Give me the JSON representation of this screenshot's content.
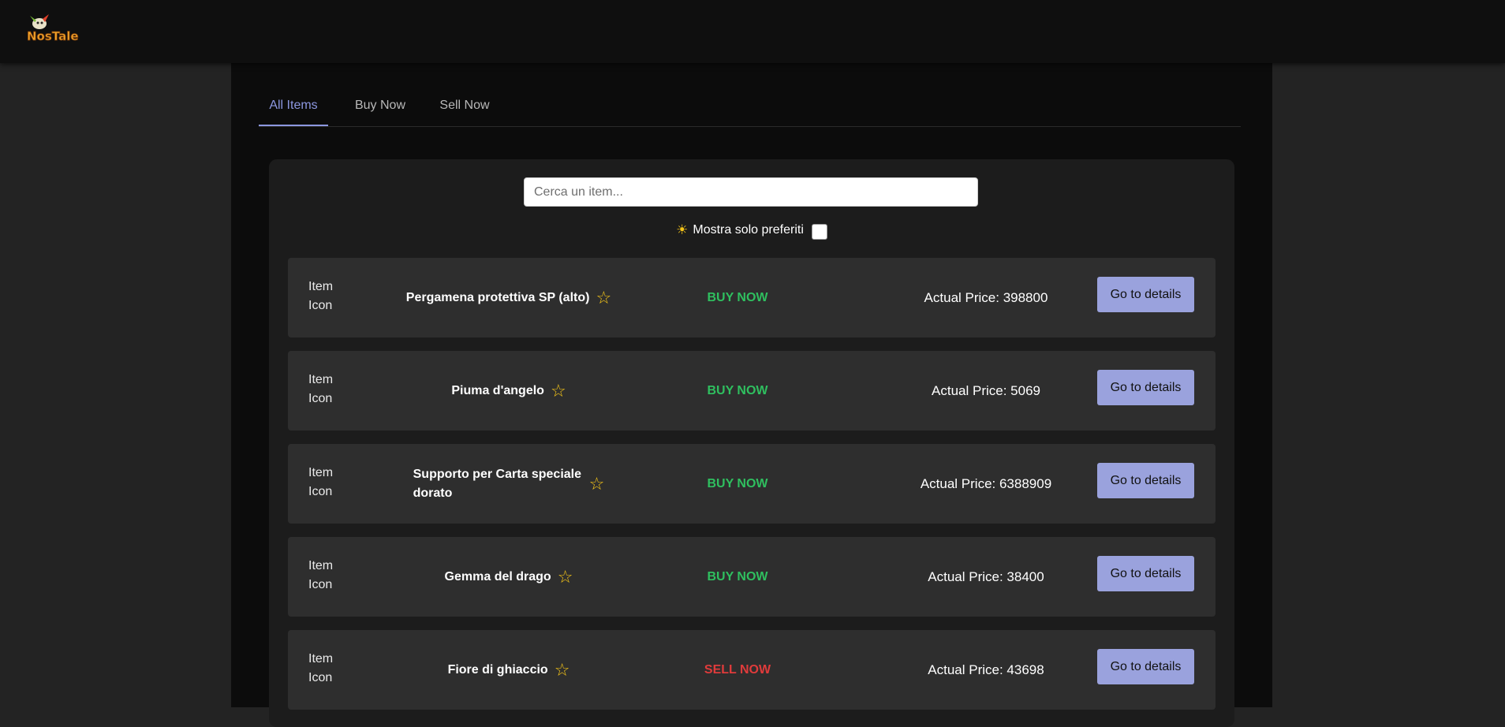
{
  "header": {
    "logo_alt": "NosTale"
  },
  "tabs": [
    {
      "label": "All Items",
      "active": true
    },
    {
      "label": "Buy Now",
      "active": false
    },
    {
      "label": "Sell Now",
      "active": false
    }
  ],
  "search": {
    "placeholder": "Cerca un item...",
    "value": ""
  },
  "favorites": {
    "icon": "sun-icon",
    "label": "Mostra solo preferiti",
    "checked": false
  },
  "items": [
    {
      "icon_alt": "Item Icon",
      "name": "Pergamena protettiva SP (alto)",
      "action": "BUY NOW",
      "action_type": "buy",
      "price": "Actual Price: 398800",
      "button": "Go to details"
    },
    {
      "icon_alt": "Item Icon",
      "name": "Piuma d'angelo",
      "action": "BUY NOW",
      "action_type": "buy",
      "price": "Actual Price: 5069",
      "button": "Go to details"
    },
    {
      "icon_alt": "Item Icon",
      "name": "Supporto per Carta speciale dorato",
      "action": "BUY NOW",
      "action_type": "buy",
      "price": "Actual Price: 6388909",
      "button": "Go to details"
    },
    {
      "icon_alt": "Item Icon",
      "name": "Gemma del drago",
      "action": "BUY NOW",
      "action_type": "buy",
      "price": "Actual Price: 38400",
      "button": "Go to details"
    },
    {
      "icon_alt": "Item Icon",
      "name": "Fiore di ghiaccio",
      "action": "SELL NOW",
      "action_type": "sell",
      "price": "Actual Price: 43698",
      "button": "Go to details"
    }
  ],
  "colors": {
    "accent": "#9aa2dd",
    "buy": "#2fbf5f",
    "sell": "#e03b3b",
    "star": "#f5c518"
  }
}
